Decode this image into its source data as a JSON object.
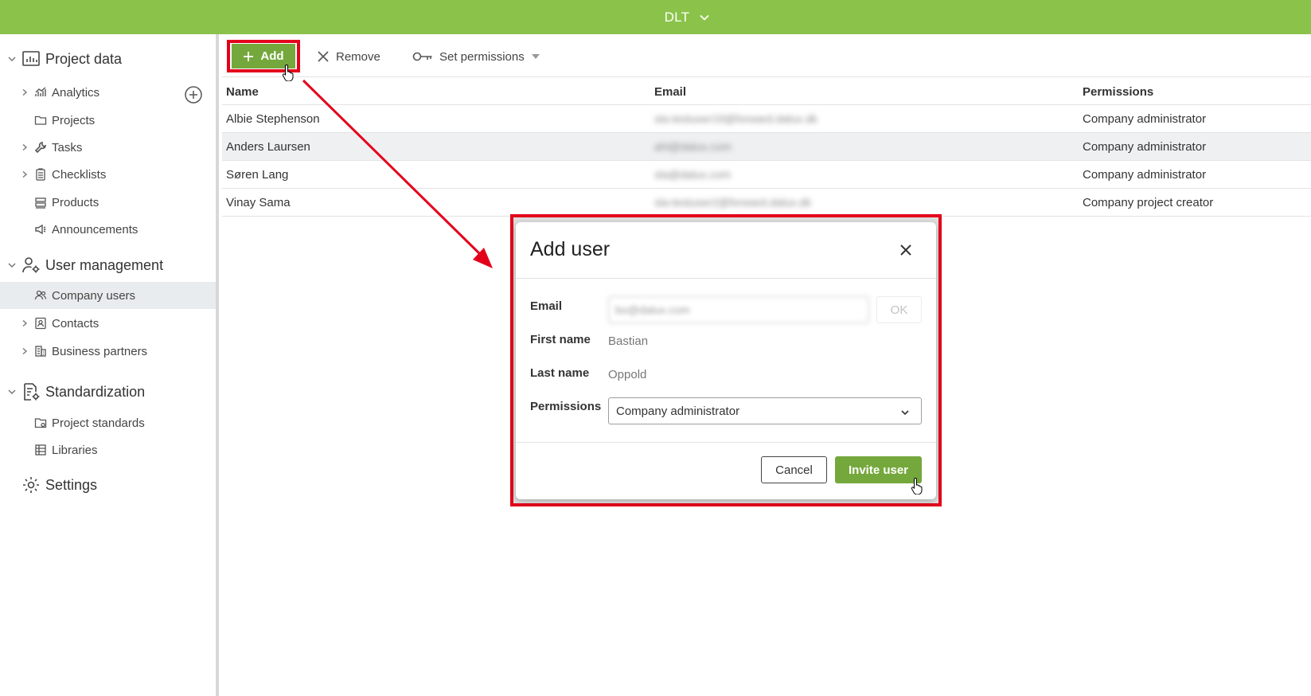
{
  "header": {
    "title": "DLT"
  },
  "sidebar": {
    "sections": [
      {
        "label": "Project data",
        "icon": "chart-board-icon"
      },
      {
        "label": "User management",
        "icon": "user-gear-icon"
      },
      {
        "label": "Standardization",
        "icon": "document-gear-icon"
      },
      {
        "label": "Settings",
        "icon": "gear-icon"
      }
    ],
    "project_items": [
      {
        "label": "Analytics",
        "icon": "analytics-icon"
      },
      {
        "label": "Projects",
        "icon": "folder-icon"
      },
      {
        "label": "Tasks",
        "icon": "wrench-icon"
      },
      {
        "label": "Checklists",
        "icon": "checklist-icon"
      },
      {
        "label": "Products",
        "icon": "products-icon"
      },
      {
        "label": "Announcements",
        "icon": "megaphone-icon"
      }
    ],
    "user_items": [
      {
        "label": "Company users",
        "icon": "users-icon"
      },
      {
        "label": "Contacts",
        "icon": "contact-card-icon"
      },
      {
        "label": "Business partners",
        "icon": "building-icon"
      }
    ],
    "standard_items": [
      {
        "label": "Project standards",
        "icon": "standard-icon"
      },
      {
        "label": "Libraries",
        "icon": "library-icon"
      }
    ]
  },
  "toolbar": {
    "add_label": "Add",
    "remove_label": "Remove",
    "permissions_label": "Set permissions"
  },
  "table": {
    "columns": [
      "Name",
      "Email",
      "Permissions"
    ],
    "rows": [
      {
        "name": "Albie Stephenson",
        "email": "sla-testuser19@forward.dalux.dk",
        "permissions": "Company administrator"
      },
      {
        "name": "Anders Laursen",
        "email": "ahl@dalux.com",
        "permissions": "Company administrator"
      },
      {
        "name": "Søren Lang",
        "email": "sla@dalux.com",
        "permissions": "Company administrator"
      },
      {
        "name": "Vinay Sama",
        "email": "sla-testuser2@forward.dalux.dk",
        "permissions": "Company project creator"
      }
    ]
  },
  "dialog": {
    "title": "Add user",
    "email_label": "Email",
    "email_value": "bo@dalux.com",
    "ok_label": "OK",
    "first_name_label": "First name",
    "first_name_value": "Bastian",
    "last_name_label": "Last name",
    "last_name_value": "Oppold",
    "permissions_label": "Permissions",
    "permissions_value": "Company administrator",
    "cancel_label": "Cancel",
    "invite_label": "Invite user"
  },
  "colors": {
    "brand": "#8bc34a",
    "button": "#74a83c",
    "highlight": "#e3001b"
  }
}
